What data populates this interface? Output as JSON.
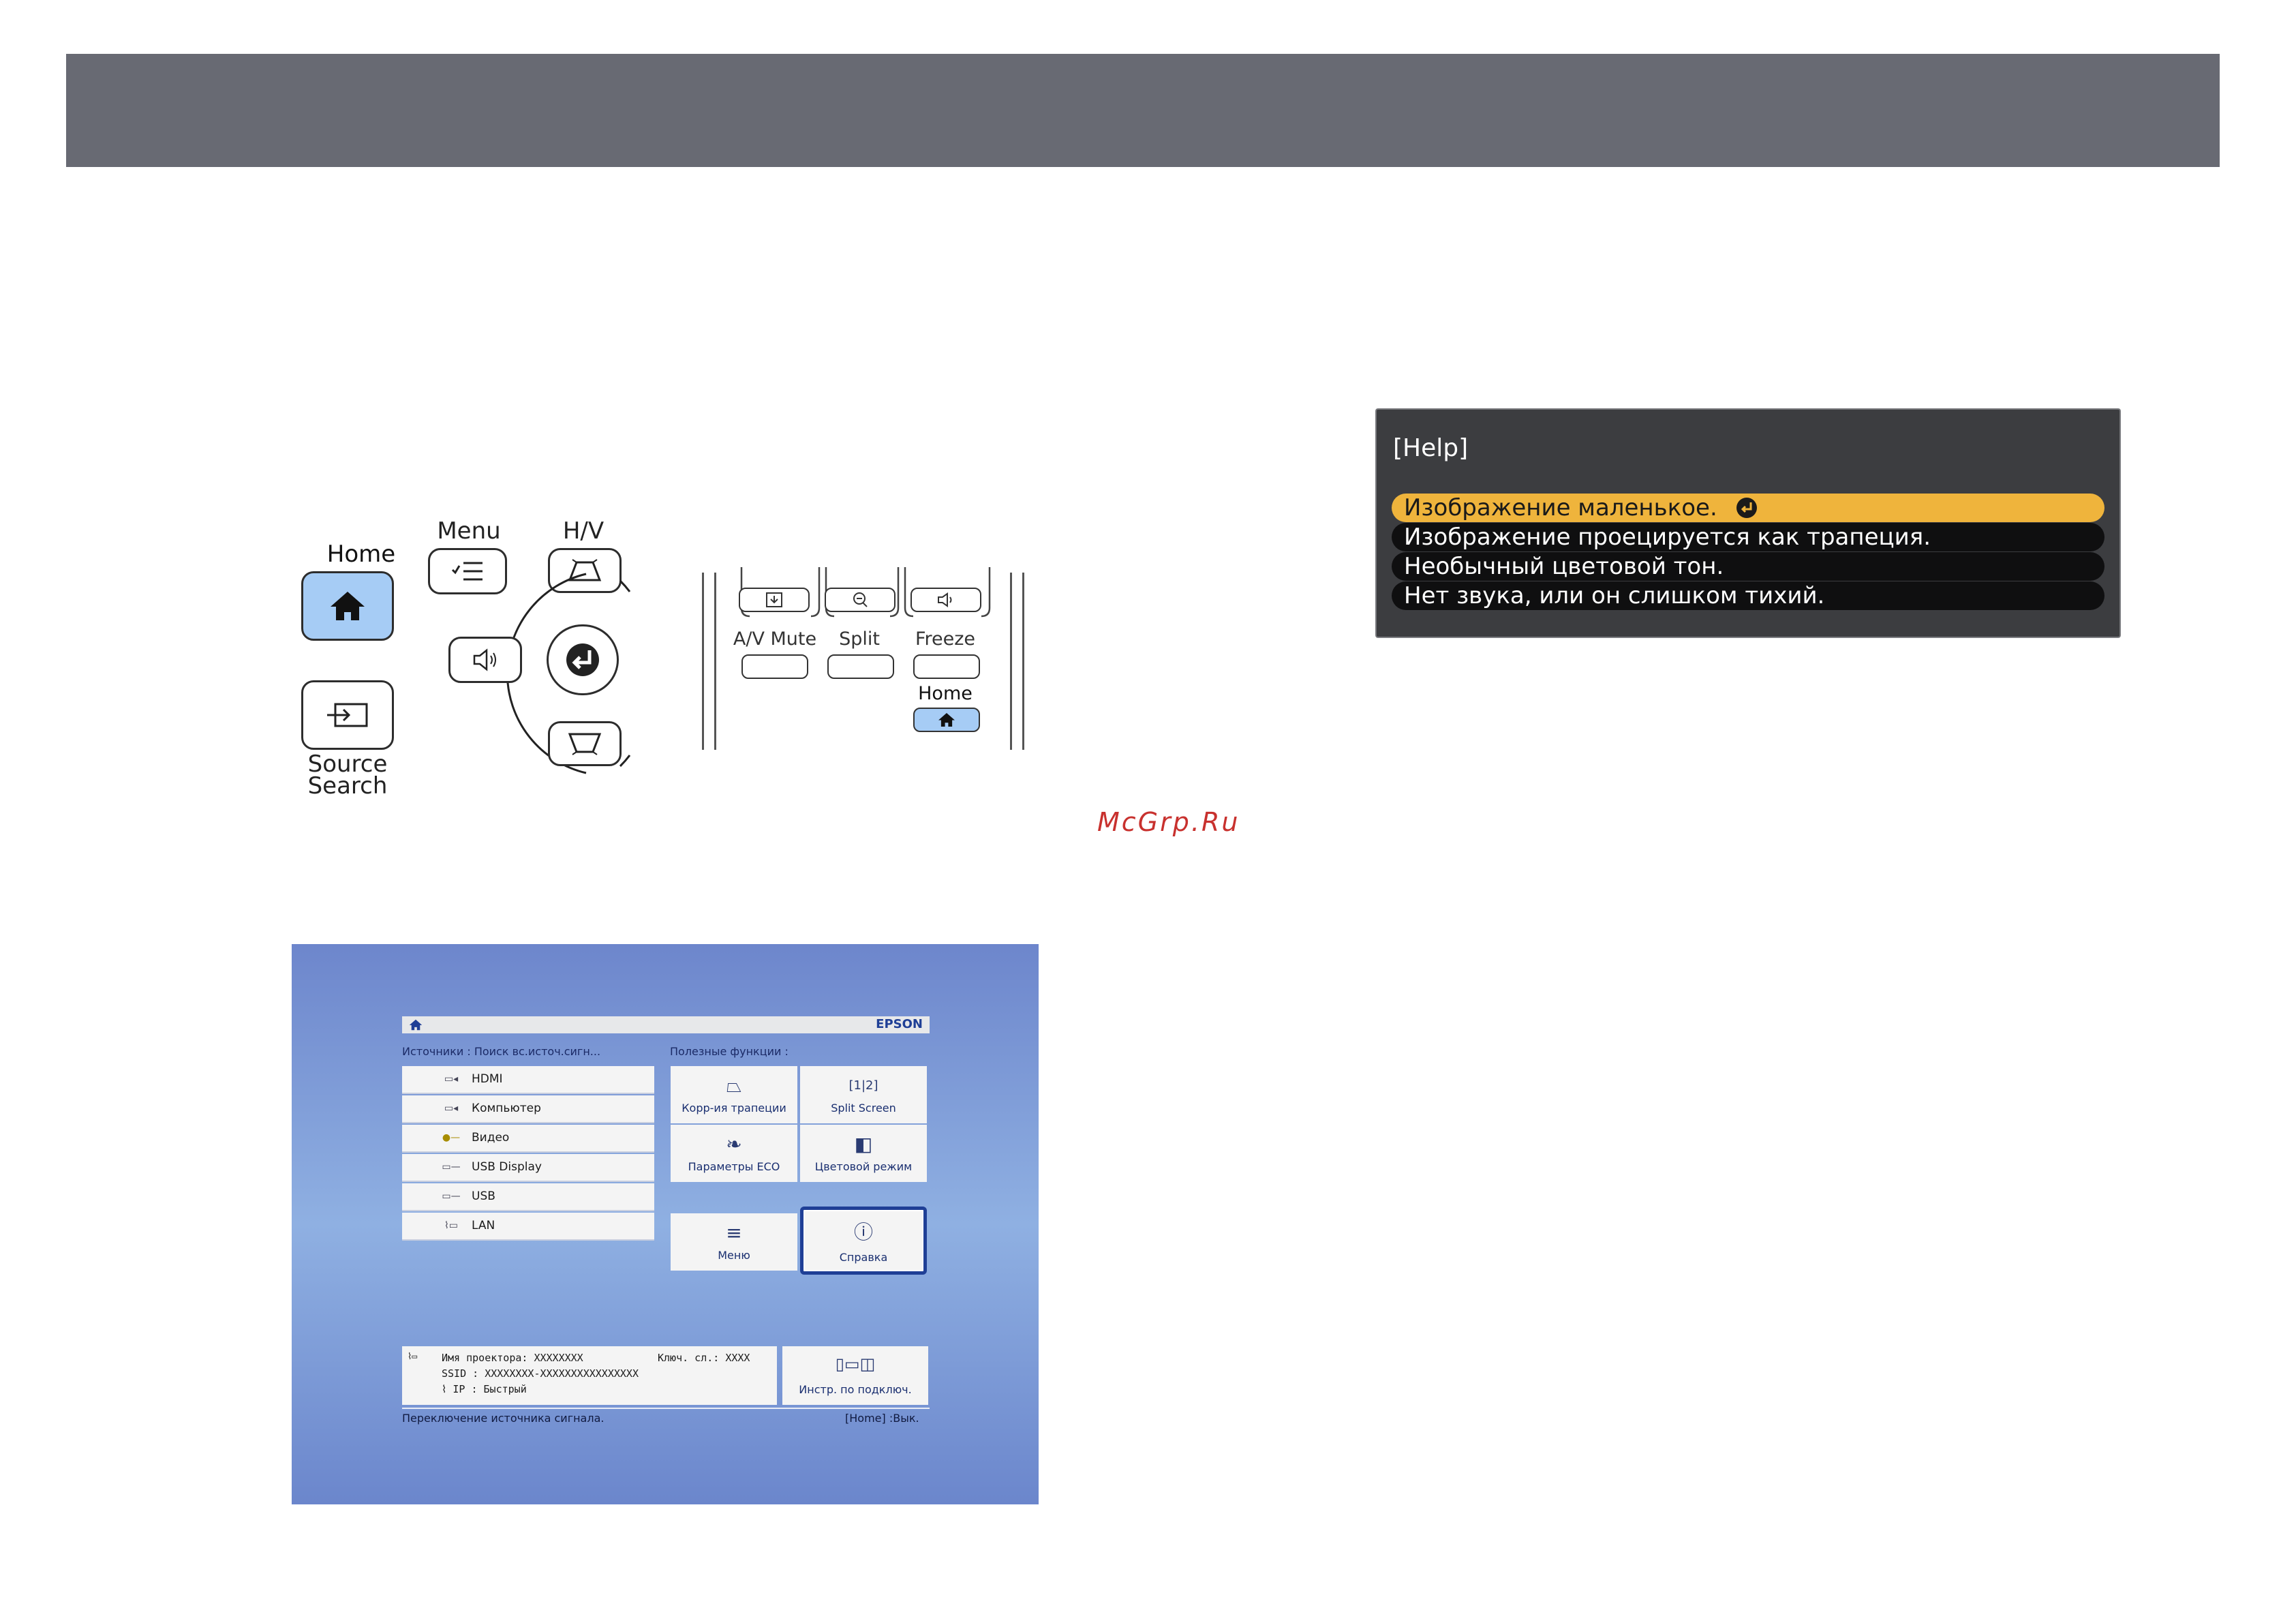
{
  "remote_left": {
    "home_label": "Home",
    "menu_label": "Menu",
    "hv_label": "H/V",
    "source_label_line1": "Source",
    "source_label_line2": "Search"
  },
  "remote_right": {
    "av_mute_label": "A/V Mute",
    "split_label": "Split",
    "freeze_label": "Freeze",
    "home_label": "Home"
  },
  "watermark": "McGrp.Ru",
  "help": {
    "title": "[Help]",
    "items": [
      "Изображение маленькое.",
      "Изображение проецируется как трапеция.",
      "Необычный цветовой тон.",
      "Нет звука, или он слишком тихий."
    ],
    "selected_index": 0
  },
  "home_screen": {
    "brand": "EPSON",
    "sources_header": "Источники : Поиск вс.источ.сигн...",
    "functions_header": "Полезные функции :",
    "sources": [
      {
        "icon": "hdmi-icon",
        "label": "HDMI"
      },
      {
        "icon": "computer-icon",
        "label": "Компьютер"
      },
      {
        "icon": "video-icon",
        "label": "Видео"
      },
      {
        "icon": "usb-display-icon",
        "label": "USB Display"
      },
      {
        "icon": "usb-icon",
        "label": "USB"
      },
      {
        "icon": "lan-icon",
        "label": "LAN"
      }
    ],
    "functions": [
      {
        "icon": "keystone-icon",
        "label": "Корр-ия трапеции"
      },
      {
        "icon": "split-screen-icon",
        "label": "Split Screen"
      },
      {
        "icon": "eco-leaf-icon",
        "label": "Параметры ECO"
      },
      {
        "icon": "color-mode-icon",
        "label": "Цветовой режим"
      },
      {
        "icon": "menu-icon",
        "label": "Меню"
      },
      {
        "icon": "help-icon",
        "label": "Справка"
      }
    ],
    "info": {
      "projector_name_label": "Имя проектора:",
      "projector_name_value": "XXXXXXXX",
      "key_label": "Ключ. сл.:",
      "key_value": "XXXX",
      "ssid_label": "SSID :",
      "ssid_value": "XXXXXXXX-XXXXXXXXXXXXXXXX",
      "ip_label": "IP :",
      "ip_value": "Быстрый"
    },
    "connection_label": "Инстр. по подключ.",
    "status_left": "Переключение источника сигнала.",
    "status_right": "[Home] :Вык."
  },
  "colors": {
    "header": "#686a73",
    "home_key": "#a6ccf5",
    "help_selected": "#efb43c",
    "watermark": "#c8312e"
  }
}
